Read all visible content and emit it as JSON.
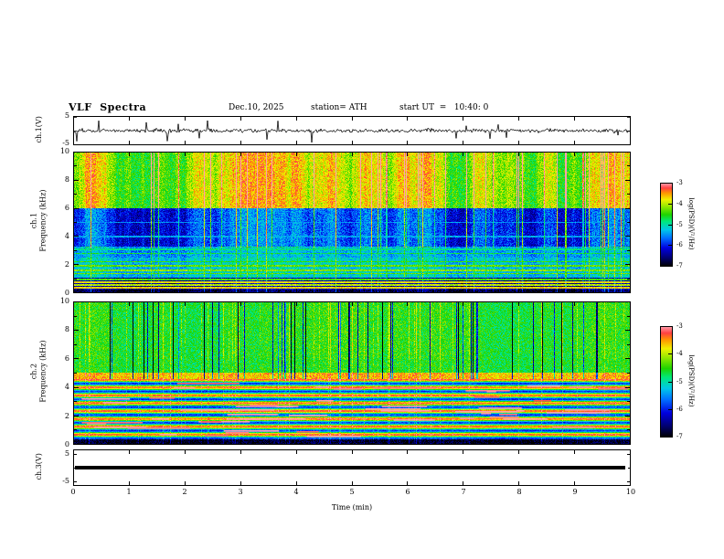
{
  "header": {
    "title": "VLF  Spectra",
    "date": "Dec.10, 2025",
    "station": "station= ATH",
    "start_ut": "start UT  =   10:40: 0"
  },
  "x_axis": {
    "label": "Time  (min)",
    "ticks": [
      "0",
      "1",
      "2",
      "3",
      "4",
      "5",
      "6",
      "7",
      "8",
      "9",
      "10"
    ],
    "range": [
      0,
      10
    ]
  },
  "panels": {
    "waveform": {
      "ylabel": "ch.1(V)",
      "yticks": [
        "5",
        "-5"
      ]
    },
    "spec1": {
      "ylabel_line1": "ch.1",
      "ylabel_line2": "Frequency  (kHz)",
      "yticks": [
        "10",
        "8",
        "6",
        "4",
        "2",
        "0"
      ]
    },
    "spec2": {
      "ylabel_line1": "ch.2",
      "ylabel_line2": "Frequency  (kHz)",
      "yticks": [
        "10",
        "8",
        "6",
        "4",
        "2",
        "0"
      ]
    },
    "ch3": {
      "ylabel": "ch.3(V)",
      "yticks": [
        "5",
        "-5"
      ]
    }
  },
  "colorbars": [
    {
      "label": "log(PSD)(V²/Hz)",
      "ticks": [
        "-3",
        "-4",
        "-5",
        "-6",
        "-7"
      ],
      "range": [
        -7,
        -3
      ]
    },
    {
      "label": "log(PSD)(V²/Hz)",
      "ticks": [
        "-3",
        "-4",
        "-5",
        "-6",
        "-7"
      ],
      "range": [
        -7,
        -3
      ]
    }
  ],
  "colormap": {
    "stops": [
      [
        0,
        "#000000"
      ],
      [
        0.1,
        "#000070"
      ],
      [
        0.22,
        "#0000e0"
      ],
      [
        0.34,
        "#0070ff"
      ],
      [
        0.44,
        "#00c8e8"
      ],
      [
        0.54,
        "#00e87a"
      ],
      [
        0.62,
        "#1ed400"
      ],
      [
        0.72,
        "#96e800"
      ],
      [
        0.8,
        "#f0f000"
      ],
      [
        0.88,
        "#ff9500"
      ],
      [
        0.94,
        "#ff4040"
      ],
      [
        1,
        "#ff9fae"
      ]
    ]
  },
  "chart_data": [
    {
      "type": "line",
      "name": "ch1_waveform",
      "ylabel": "ch.1(V)",
      "xlim": [
        0,
        10
      ],
      "ylim": [
        -5,
        5
      ],
      "yticks": [
        5,
        -5
      ],
      "description": "broadband VLF voltage waveform, noise ~±1 V around 0 V with impulsive sferic spikes reaching ±4.5 V",
      "seed": 90001,
      "sigma": 0.45,
      "spike_prob": 0.028,
      "spike_amp": [
        1.5,
        4.3
      ],
      "spike_neg_frac": 0.6
    },
    {
      "type": "heatmap",
      "name": "ch1_spectrogram",
      "ylabel": "ch.1 Frequency (kHz)",
      "xlim": [
        0,
        10
      ],
      "ylim": [
        0,
        10
      ],
      "zlabel": "log(PSD)(V²/Hz)",
      "zlim": [
        -7,
        -3
      ],
      "colorbar_ticks": [
        -3,
        -4,
        -5,
        -6,
        -7
      ],
      "seed": 90002,
      "noise": 0.35,
      "bands": [
        {
          "f": [
            0,
            0.25
          ],
          "base": -7
        },
        {
          "f": [
            0.25,
            1.1
          ],
          "base": -6.6
        },
        {
          "f": [
            1.1,
            2.5
          ],
          "base": -5.4
        },
        {
          "f": [
            2.5,
            3.3
          ],
          "base": -5.6
        },
        {
          "f": [
            3.3,
            6
          ],
          "base": -6.3
        },
        {
          "f": [
            6,
            10
          ],
          "base": -4.6
        }
      ],
      "lines": [
        {
          "f": 0.35,
          "v": -3.7
        },
        {
          "f": 0.55,
          "v": -4.0
        },
        {
          "f": 0.75,
          "v": -3.8
        },
        {
          "f": 0.95,
          "v": -4.4
        },
        {
          "f": 1.35,
          "v": -4.3
        },
        {
          "f": 1.6,
          "v": -4.2
        },
        {
          "f": 1.9,
          "v": -4.3
        },
        {
          "f": 2.2,
          "v": -4.5
        },
        {
          "f": 2.8,
          "v": -4.7
        },
        {
          "f": 3.1,
          "v": -4.9
        },
        {
          "f": 4.0,
          "v": -5.4
        },
        {
          "f": 5.0,
          "v": -5.5
        }
      ],
      "streaks": {
        "prob": 0.1,
        "gain_low": 0.6,
        "gain_mid": 1.3,
        "gain_high": 1.6
      }
    },
    {
      "type": "heatmap",
      "name": "ch2_spectrogram",
      "ylabel": "ch.2 Frequency (kHz)",
      "xlim": [
        0,
        10
      ],
      "ylim": [
        0,
        10
      ],
      "zlabel": "log(PSD)(V²/Hz)",
      "zlim": [
        -7,
        -3
      ],
      "colorbar_ticks": [
        -3,
        -4,
        -5,
        -6,
        -7
      ],
      "seed": 90003,
      "noise": 0.35,
      "bands": [
        {
          "f": [
            0,
            0.35
          ],
          "base": -7
        },
        {
          "f": [
            0.35,
            4.6
          ],
          "base": -4.7,
          "striped": true,
          "stripe_period": 0.55,
          "stripe_amp": 1.3
        },
        {
          "f": [
            4.6,
            5.0
          ],
          "base": -3.75
        },
        {
          "f": [
            5,
            10
          ],
          "base": -4.7
        }
      ],
      "streaks": {
        "prob": 0.09,
        "gain_low": 0.3,
        "gain_mid": 0.3,
        "gain_high": 0.4,
        "dip": [
          -2.8,
          -1.2
        ],
        "dip_fmin": 4.6
      },
      "dashes": {
        "count": 55,
        "f_range": [
          0.5,
          4.4
        ],
        "v": -3.2,
        "len": [
          8,
          70
        ]
      }
    },
    {
      "type": "line",
      "name": "ch3_waveform",
      "ylabel": "ch.3(V)",
      "xlim": [
        0,
        10
      ],
      "ylim": [
        -5,
        5
      ],
      "yticks": [
        5,
        -5
      ],
      "description": "flat constant trace at 0 V drawn as a thick black line",
      "value": 0,
      "line_width": 4
    }
  ]
}
